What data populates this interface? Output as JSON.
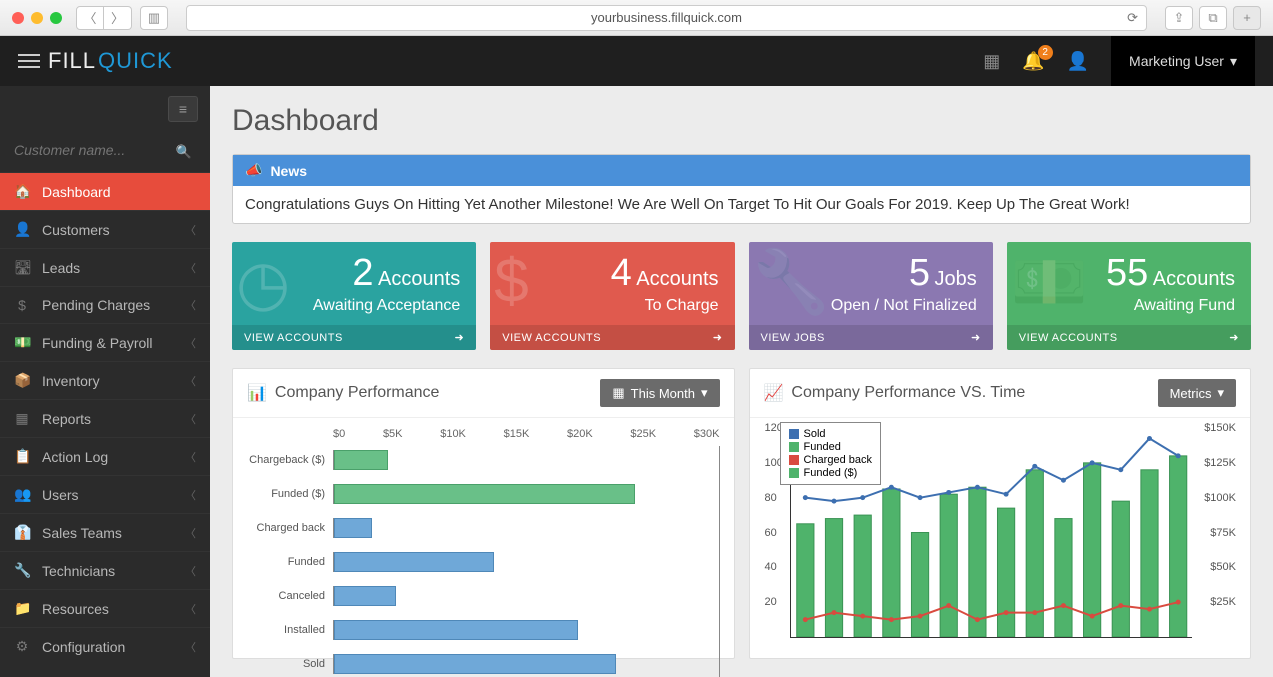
{
  "browser": {
    "url": "yourbusiness.fillquick.com"
  },
  "header": {
    "logo_fill": "FILL",
    "logo_quick": "QUICK",
    "notif_count": "2",
    "user_label": "Marketing User"
  },
  "sidebar": {
    "search_placeholder": "Customer name...",
    "items": [
      {
        "label": "Dashboard",
        "icon": "🏠"
      },
      {
        "label": "Customers",
        "icon": "👤"
      },
      {
        "label": "Leads",
        "icon": "🛣"
      },
      {
        "label": "Pending Charges",
        "icon": "$"
      },
      {
        "label": "Funding & Payroll",
        "icon": "💵"
      },
      {
        "label": "Inventory",
        "icon": "📦"
      },
      {
        "label": "Reports",
        "icon": "▦"
      },
      {
        "label": "Action Log",
        "icon": "📋"
      },
      {
        "label": "Users",
        "icon": "👥"
      },
      {
        "label": "Sales Teams",
        "icon": "👔"
      },
      {
        "label": "Technicians",
        "icon": "🔧"
      },
      {
        "label": "Resources",
        "icon": "📁"
      },
      {
        "label": "Configuration",
        "icon": "⚙"
      }
    ]
  },
  "page": {
    "title": "Dashboard"
  },
  "news": {
    "heading": "News",
    "body": "Congratulations Guys On Hitting Yet Another Milestone! We Are Well On Target To Hit Our Goals For 2019. Keep Up The Great Work!"
  },
  "stats": [
    {
      "count": "2",
      "unit": "Accounts",
      "sub": "Awaiting Acceptance",
      "footer": "VIEW ACCOUNTS",
      "color": "sc-teal",
      "icon": "◷"
    },
    {
      "count": "4",
      "unit": "Accounts",
      "sub": "To Charge",
      "footer": "VIEW ACCOUNTS",
      "color": "sc-red",
      "icon": "$"
    },
    {
      "count": "5",
      "unit": "Jobs",
      "sub": "Open / Not Finalized",
      "footer": "VIEW JOBS",
      "color": "sc-purple",
      "icon": "🔧"
    },
    {
      "count": "55",
      "unit": "Accounts",
      "sub": "Awaiting Fund",
      "footer": "VIEW ACCOUNTS",
      "color": "sc-green",
      "icon": "💵"
    }
  ],
  "chart1": {
    "title": "Company Performance",
    "period_btn": "This Month",
    "x_ticks": [
      "$0",
      "$5K",
      "$10K",
      "$15K",
      "$20K",
      "$25K",
      "$30K"
    ]
  },
  "chart2": {
    "title": "Company Performance VS. Time",
    "btn": "Metrics",
    "legend": [
      "Sold",
      "Funded",
      "Charged back",
      "Funded ($)"
    ],
    "y_left": [
      "120",
      "100",
      "80",
      "60",
      "40",
      "20"
    ],
    "y_right": [
      "$150K",
      "$125K",
      "$100K",
      "$75K",
      "$50K",
      "$25K"
    ]
  },
  "chart_data": [
    {
      "type": "bar",
      "orientation": "horizontal",
      "title": "Company Performance",
      "xlabel": "$",
      "x_ticks": [
        0,
        5000,
        10000,
        15000,
        20000,
        25000,
        30000
      ],
      "xlim": [
        0,
        30000
      ],
      "categories": [
        "Chargeback ($)",
        "Funded ($)",
        "Charged back",
        "Funded",
        "Canceled",
        "Installed",
        "Sold"
      ],
      "values": [
        4200,
        23500,
        3000,
        12500,
        4800,
        19000,
        22000
      ],
      "colors": [
        "green",
        "green",
        "blue",
        "blue",
        "blue",
        "blue",
        "blue"
      ]
    },
    {
      "type": "combo",
      "title": "Company Performance VS. Time",
      "x_count": 14,
      "y_left": {
        "label": "count",
        "lim": [
          0,
          120
        ],
        "ticks": [
          20,
          40,
          60,
          80,
          100,
          120
        ]
      },
      "y_right": {
        "label": "$",
        "lim": [
          0,
          150000
        ],
        "ticks": [
          25000,
          50000,
          75000,
          100000,
          125000,
          150000
        ]
      },
      "series": [
        {
          "name": "Sold",
          "type": "line",
          "axis": "left",
          "color": "#3d6fb0",
          "values": [
            80,
            78,
            80,
            86,
            80,
            83,
            86,
            82,
            98,
            90,
            100,
            96,
            114,
            104
          ]
        },
        {
          "name": "Funded",
          "type": "bar",
          "axis": "left",
          "color": "#4fb36b",
          "values": [
            65,
            68,
            70,
            85,
            60,
            82,
            86,
            74,
            96,
            68,
            100,
            78,
            96,
            104
          ]
        },
        {
          "name": "Charged back",
          "type": "line",
          "axis": "left",
          "color": "#d94b3f",
          "values": [
            10,
            14,
            12,
            10,
            12,
            18,
            10,
            14,
            14,
            18,
            12,
            18,
            16,
            20
          ]
        },
        {
          "name": "Funded ($)",
          "type": "bar",
          "axis": "right",
          "color": "#4fb36b",
          "values": [
            80000,
            82000,
            85000,
            104000,
            73000,
            100000,
            105000,
            90000,
            117000,
            83000,
            122000,
            95000,
            117000,
            127000
          ]
        }
      ]
    }
  ]
}
